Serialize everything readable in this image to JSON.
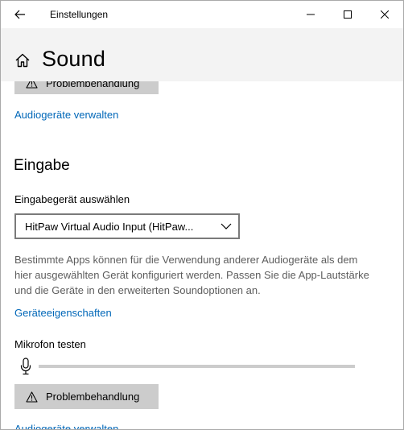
{
  "window": {
    "app_title": "Einstellungen",
    "page_title": "Sound"
  },
  "output_section": {
    "troubleshoot_label": "Problembehandlung",
    "manage_devices_link": "Audiogeräte verwalten"
  },
  "input_section": {
    "heading": "Eingabe",
    "device_select_label": "Eingabegerät auswählen",
    "selected_device": "HitPaw Virtual Audio Input (HitPaw...",
    "description": "Bestimmte Apps können für die Verwendung anderer Audiogeräte als dem hier ausgewählten Gerät konfiguriert werden. Passen Sie die App-Lautstärke und die Geräte in den erweiterten Soundoptionen an.",
    "device_properties_link": "Geräteeigenschaften",
    "test_mic_label": "Mikrofon testen",
    "mic_level": 0,
    "troubleshoot_label": "Problembehandlung",
    "manage_devices_link": "Audiogeräte verwalten"
  },
  "colors": {
    "link": "#0067b8",
    "button_bg": "#cccccc",
    "header_bg": "#f3f3f3"
  },
  "icons": {
    "back": "back-arrow-icon",
    "minimize": "minimize-icon",
    "maximize": "maximize-icon",
    "close": "close-icon",
    "home": "home-icon",
    "warning": "warning-icon",
    "microphone": "microphone-icon",
    "chevron": "chevron-down-icon"
  }
}
